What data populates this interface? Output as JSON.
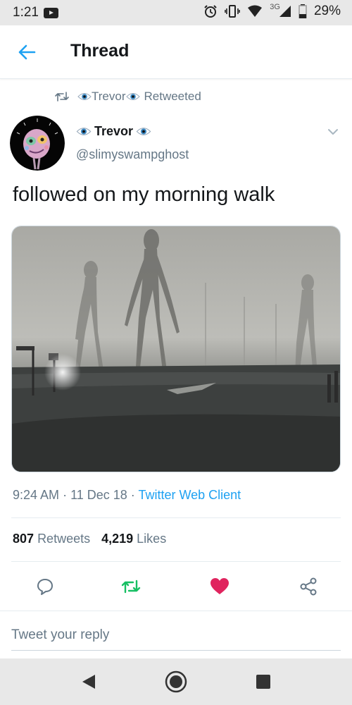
{
  "status_bar": {
    "time": "1:21",
    "network": "3G",
    "battery": "29%"
  },
  "header": {
    "title": "Thread"
  },
  "retweet_context": {
    "name": "Trevor",
    "label": "Retweeted"
  },
  "tweet": {
    "author_name": "Trevor",
    "author_handle": "@slimyswampghost",
    "text": "followed on my morning walk",
    "time": "9:24 AM",
    "date": "11 Dec 18",
    "source": "Twitter Web Client",
    "retweets": {
      "count": "807",
      "label": "Retweets"
    },
    "likes": {
      "count": "4,219",
      "label": "Likes"
    }
  },
  "reply": {
    "placeholder": "Tweet your reply"
  },
  "colors": {
    "accent": "#1da1f2",
    "retweet_green": "#17bf63",
    "like_red": "#e0245e",
    "secondary_text": "#657786"
  },
  "icons": {
    "back": "arrow-left-icon",
    "retweet": "retweet-icon",
    "eye": "eye-emoji-icon",
    "caret": "chevron-down-icon",
    "reply": "reply-bubble-icon",
    "like": "heart-icon",
    "share": "share-icon"
  }
}
